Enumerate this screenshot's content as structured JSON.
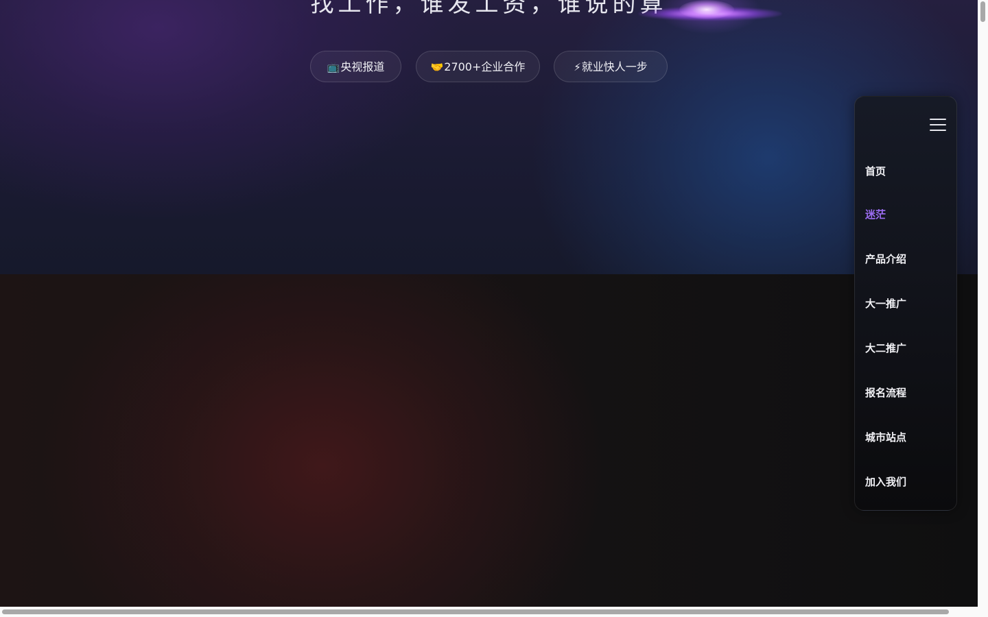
{
  "hero": {
    "title": "找工作，谁发工资，谁说的算"
  },
  "pills": [
    {
      "icon": "📺",
      "icon_name": "tv-icon",
      "label": "央视报道"
    },
    {
      "icon": "🤝",
      "icon_name": "handshake-icon",
      "label": "2700+企业合作"
    },
    {
      "icon": "⚡",
      "icon_name": "lightning-icon",
      "label": "就业快人一步"
    }
  ],
  "nav": {
    "menu_icon": "hamburger-menu-icon",
    "active_color": "#9b6cf0",
    "items": [
      {
        "label": "首页"
      },
      {
        "label": "迷茫",
        "active": true
      },
      {
        "label": "产品介绍"
      },
      {
        "label": "大一推广"
      },
      {
        "label": "大二推广"
      },
      {
        "label": "报名流程"
      },
      {
        "label": "城市站点"
      },
      {
        "label": "加入我们"
      }
    ]
  }
}
